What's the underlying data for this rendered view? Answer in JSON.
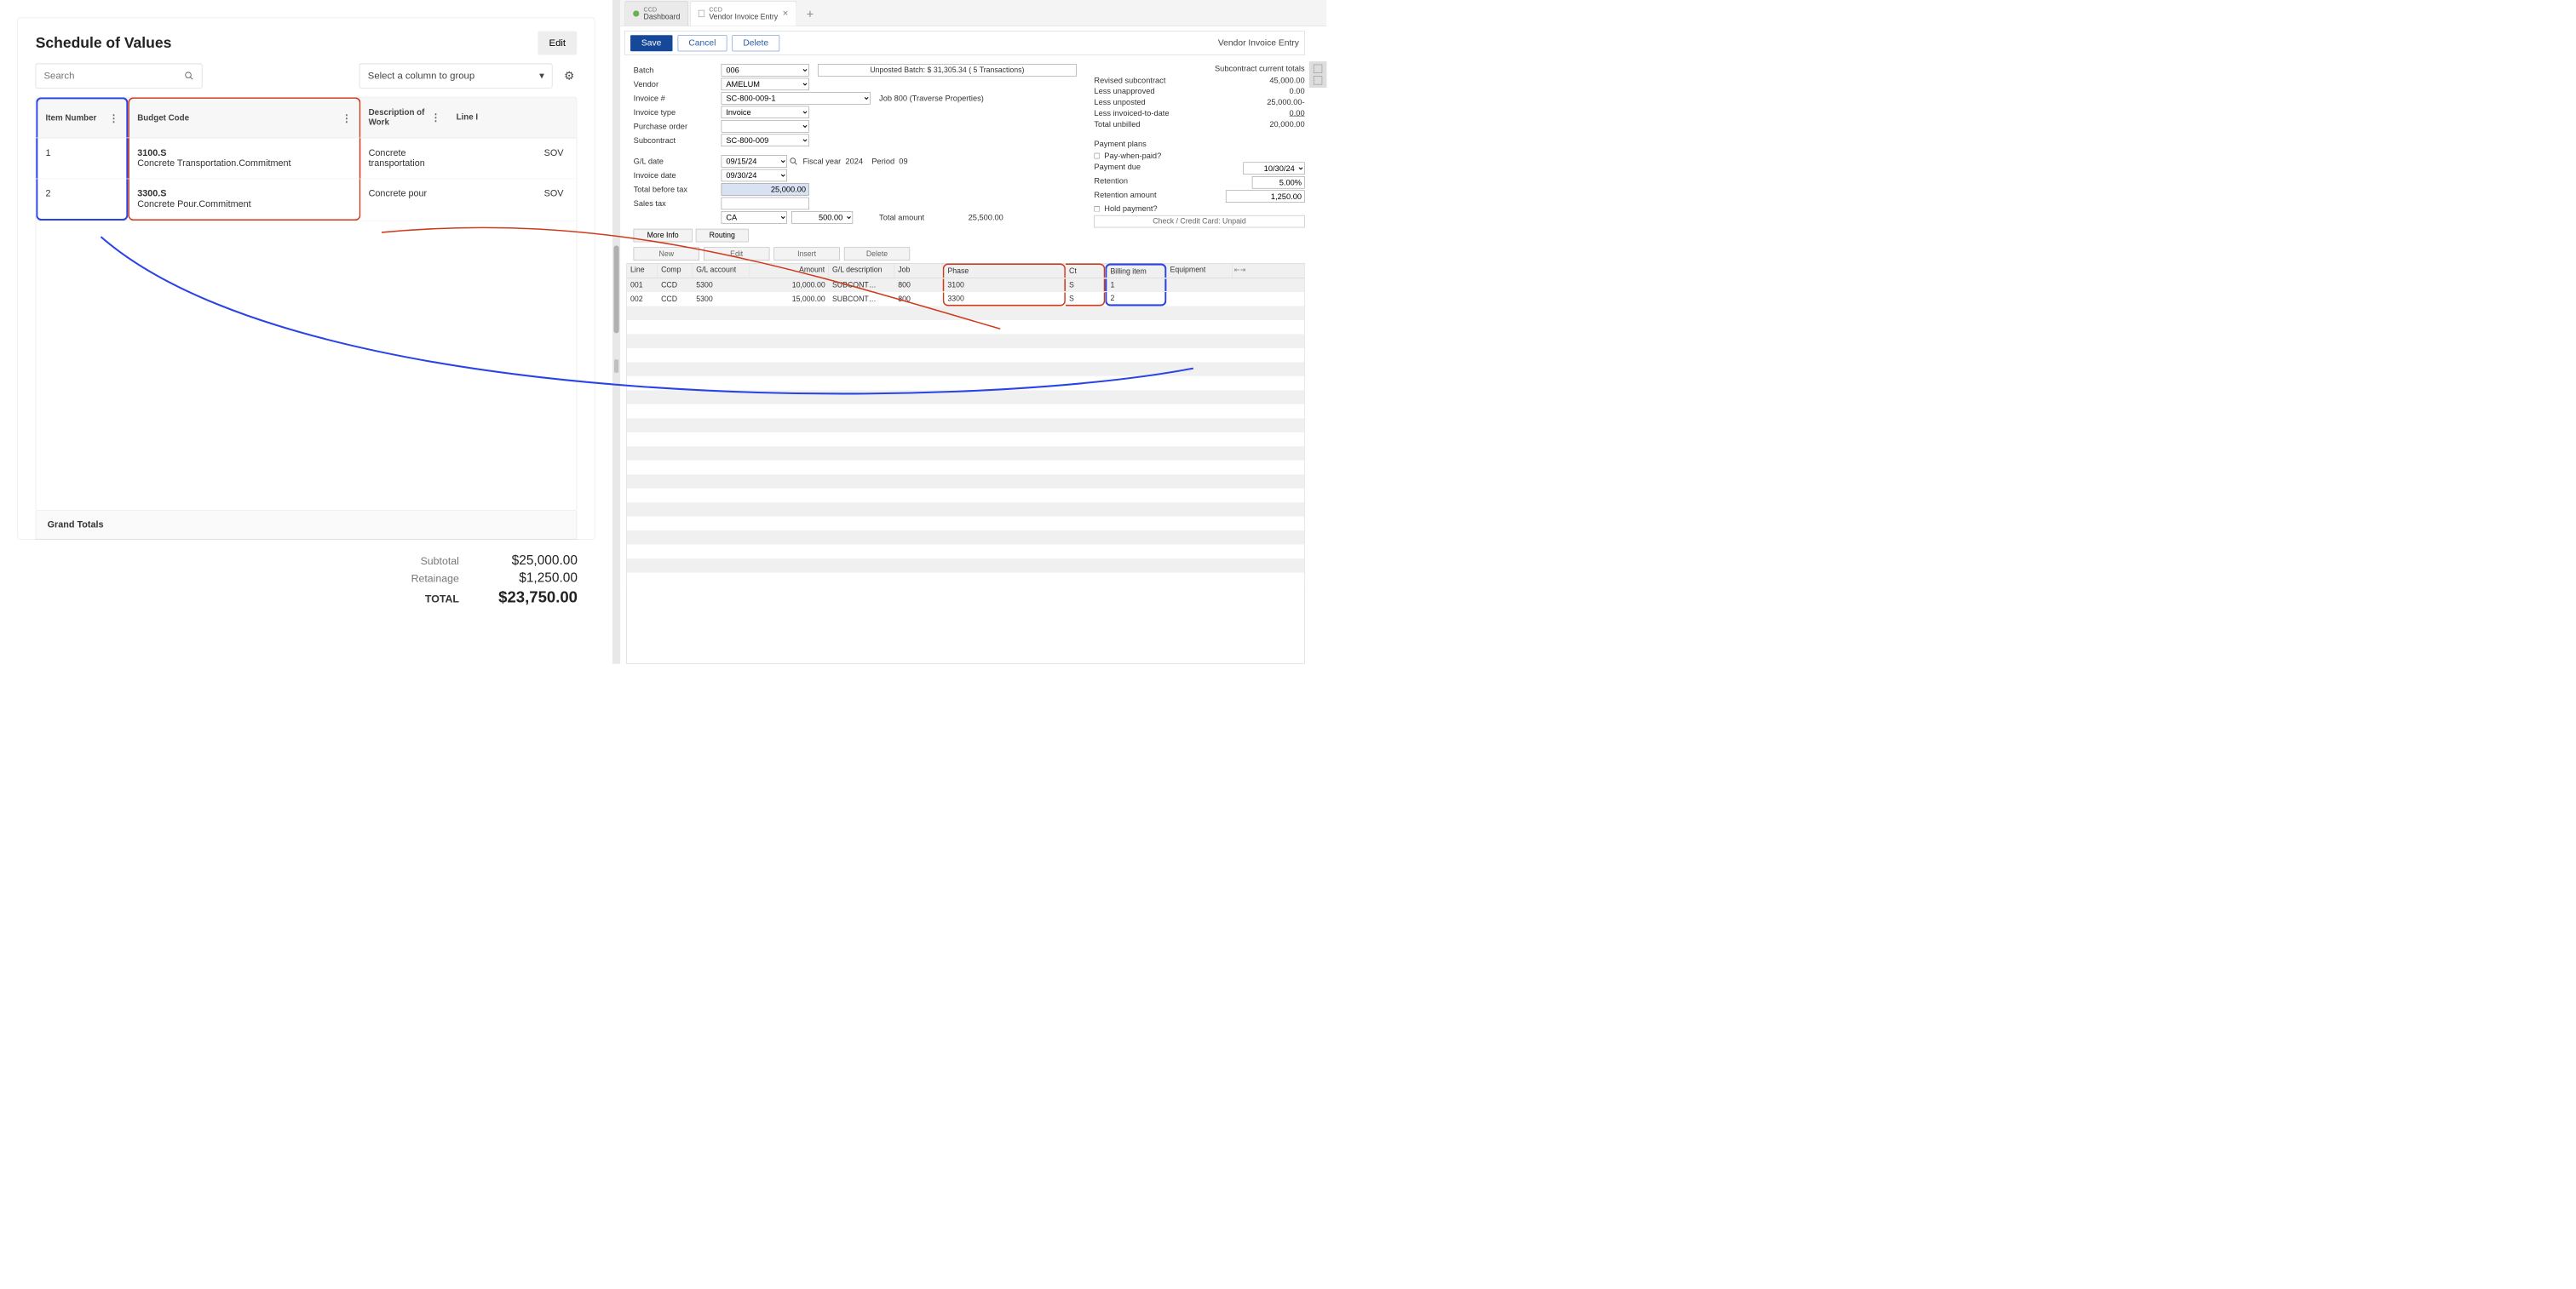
{
  "left": {
    "title": "Schedule of Values",
    "edit": "Edit",
    "searchPlaceholder": "Search",
    "groupPlaceholder": "Select a column to group",
    "columns": {
      "itemNumber": "Item Number",
      "budgetCode": "Budget Code",
      "description": "Description of Work",
      "lineItem": "Line I"
    },
    "rows": [
      {
        "item": "1",
        "code": "3100.S",
        "codeLabel": "Concrete Transportation.Commitment",
        "desc": "Concrete transportation",
        "line": "SOV"
      },
      {
        "item": "2",
        "code": "3300.S",
        "codeLabel": "Concrete Pour.Commitment",
        "desc": "Concrete pour",
        "line": "SOV"
      }
    ],
    "grandTotals": "Grand Totals",
    "subtotalLabel": "Subtotal",
    "subtotalValue": "$25,000.00",
    "retainLabel": "Retainage",
    "retainValue": "$1,250.00",
    "totalLabel": "TOTAL",
    "totalValue": "$23,750.00"
  },
  "right": {
    "tabs": {
      "t1sub": "CCD",
      "t1title": "Dashboard",
      "t2sub": "CCD",
      "t2title": "Vendor Invoice Entry"
    },
    "toolbar": {
      "save": "Save",
      "cancel": "Cancel",
      "delete": "Delete",
      "title": "Vendor Invoice Entry"
    },
    "form": {
      "batchLabel": "Batch",
      "batchVal": "006",
      "batchNote": "Unposted Batch: $ 31,305.34 ( 5 Transactions)",
      "vendorLabel": "Vendor",
      "vendorVal": "AMELUM",
      "invoiceNumLabel": "Invoice #",
      "invoiceNumVal": "SC-800-009-1",
      "jobText": "Job 800 (Traverse Properties)",
      "invoiceTypeLabel": "Invoice type",
      "invoiceTypeVal": "Invoice",
      "poLabel": "Purchase order",
      "poVal": "",
      "subcontractLabel": "Subcontract",
      "subcontractVal": "SC-800-009",
      "glDateLabel": "G/L date",
      "glDateVal": "09/15/24",
      "fiscalLabel": "Fiscal year",
      "fiscalVal": "2024",
      "periodLabel": "Period",
      "periodVal": "09",
      "invDateLabel": "Invoice date",
      "invDateVal": "09/30/24",
      "tbtLabel": "Total before tax",
      "tbtVal": "25,000.00",
      "taxLabel": "Sales tax",
      "taxVal": "",
      "taxCode": "CA",
      "taxAmount": "500.00",
      "totalAmtLabel": "Total amount",
      "totalAmtVal": "25,500.00",
      "moreInfo": "More Info",
      "routing": "Routing"
    },
    "totals": {
      "header": "Subcontract current totals",
      "revisedLabel": "Revised subcontract",
      "revisedVal": "45,000.00",
      "unapprovedLabel": "Less unapproved",
      "unapprovedVal": "0.00",
      "unpostedLabel": "Less unposted",
      "unpostedVal": "25,000.00-",
      "invtdLabel": "Less invoiced-to-date",
      "invtdVal": "0.00",
      "unbilledLabel": "Total unbilled",
      "unbilledVal": "20,000.00"
    },
    "payment": {
      "header": "Payment plans",
      "pwpLabel": "Pay-when-paid?",
      "dueLabel": "Payment due",
      "dueVal": "10/30/24",
      "retLabel": "Retention",
      "retVal": "5.00%",
      "retAmtLabel": "Retention amount",
      "retAmtVal": "1,250.00",
      "holdLabel": "Hold payment?",
      "creditNote": "Check / Credit Card: Unpaid"
    },
    "gridToolbar": {
      "new": "New",
      "edit": "Edit",
      "insert": "Insert",
      "delete": "Delete"
    },
    "gridCols": {
      "line": "Line",
      "comp": "Comp",
      "acct": "G/L account",
      "amt": "Amount",
      "desc": "G/L description",
      "job": "Job",
      "phase": "Phase",
      "ct": "Ct",
      "bill": "Billing item",
      "equip": "Equipment"
    },
    "gridRows": [
      {
        "line": "001",
        "comp": "CCD",
        "acct": "5300",
        "amt": "10,000.00",
        "desc": "SUBCONT…",
        "job": "800",
        "phase": "3100",
        "ct": "S",
        "bill": "1"
      },
      {
        "line": "002",
        "comp": "CCD",
        "acct": "5300",
        "amt": "15,000.00",
        "desc": "SUBCONT…",
        "job": "800",
        "phase": "3300",
        "ct": "S",
        "bill": "2"
      }
    ]
  }
}
